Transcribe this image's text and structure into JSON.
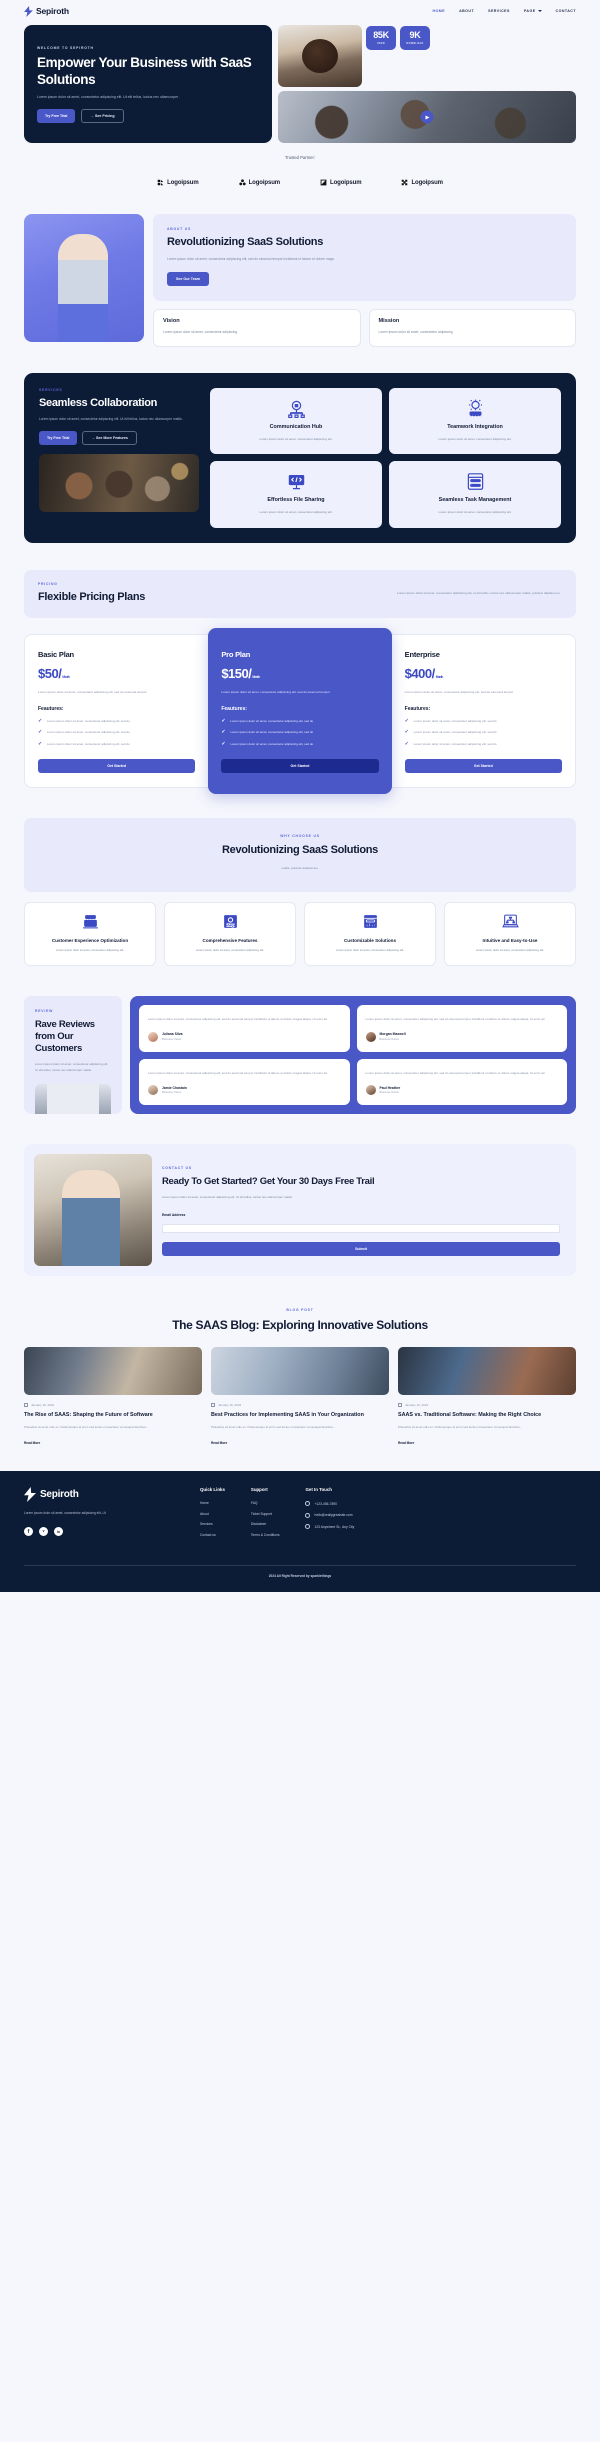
{
  "brand": {
    "name": "Sepiroth",
    "logo_icon": "lightning-bolt-icon"
  },
  "nav": {
    "items": [
      {
        "label": "HOME",
        "active": true
      },
      {
        "label": "ABOUT",
        "active": false
      },
      {
        "label": "SERVICES",
        "active": false
      },
      {
        "label": "PAGE",
        "active": false,
        "has_caret": true
      },
      {
        "label": "CONTACT",
        "active": false
      }
    ]
  },
  "hero": {
    "eyebrow": "WELCOME TO SEPIROTH",
    "title": "Empower Your Business with SaaS Solutions",
    "description": "Lorem ipsum dolor sit amet, consectetur adipiscing elit. Ut elit tellus, luctus nec ullamcorper .",
    "primary_btn": "Try Free Trial",
    "secondary_btn": "See Pricing",
    "secondary_btn_arrow": "→",
    "stats": [
      {
        "number": "85K",
        "label": "USER"
      },
      {
        "number": "9K",
        "label": "DOWNLOAD"
      }
    ],
    "play_icon": "play-icon"
  },
  "partners": {
    "title": "Trusted Partner:",
    "items": [
      {
        "name": "Logoipsum",
        "icon": "logoipsum-blocks-icon"
      },
      {
        "name": "Logoipsum",
        "icon": "logoipsum-clover-icon"
      },
      {
        "name": "Logoipsum",
        "icon": "logoipsum-leaf-icon"
      },
      {
        "name": "Logoipsum",
        "icon": "logoipsum-cross-icon"
      }
    ]
  },
  "about": {
    "eyebrow": "ABOUT US",
    "title": "Revolutionizing SaaS Solutions",
    "description": "Lorem ipsum dolor sit amet, consectetur adipiscing elit, sed do eiusmod tempor incididunt ut labore et dolore magn.",
    "button": "See Our Team",
    "cards": [
      {
        "title": "Vision",
        "text": "Lorem ipsum dolor sit amet, consectetur adipiscing"
      },
      {
        "title": "Mission",
        "text": "Lorem ipsum dolor sit amet, consectetur adipiscing"
      }
    ]
  },
  "services": {
    "eyebrow": "SERVICES",
    "title": "Seamless Collaboration",
    "description": "Lorem ipsum dolor sit amet, consectetur adipiscing elit. Ut elit tellus, luctus nec ullamcorper mattis.",
    "primary_btn": "Try Free Trial",
    "secondary_btn": "See More Features",
    "secondary_btn_arrow": "→",
    "cards": [
      {
        "title": "Communication Hub",
        "text": "Lorem ipsum dolor sit amet, consectetur adipiscing elit.",
        "icon": "network-lock-icon"
      },
      {
        "title": "Teamwork Integration",
        "text": "Lorem ipsum dolor sit amet, consectetur adipiscing elit.",
        "icon": "lightbulb-stars-icon"
      },
      {
        "title": "Effortless File Sharing",
        "text": "Lorem ipsum dolor sit amet, consectetur adipiscing elit.",
        "icon": "monitor-code-icon"
      },
      {
        "title": "Seamless Task Management",
        "text": "Lorem ipsum dolor sit amet, consectetur adipiscing elit.",
        "icon": "task-list-icon"
      }
    ]
  },
  "pricing": {
    "eyebrow": "PRICING",
    "title": "Flexible Pricing Plans",
    "description": "Lorem ipsum dolor sit amet, consectetur adipiscing elit, ut elit tellus, luctus nec ullamcorper mattis, pulvinar dapibus leo.",
    "features_label": "Feautures:",
    "plans": [
      {
        "name": "Basic Plan",
        "price": "$50/",
        "period": "Month",
        "description": "Lorem ipsum dolor sit amet, consectetur adipiscing elit, sed do eiuemod tempor",
        "features": [
          "Lorem ipsum dolor sit amet, consectetur adipiscing elit, sed do",
          "Lorem ipsum dolor sit amet, consectetur adipiscing elit, sed do",
          "Lorem ipsum dolor sit amet, consectetur adipiscing elit, sed do"
        ],
        "button": "Get Started",
        "featured": false
      },
      {
        "name": "Pro Plan",
        "price": "$150/",
        "period": "Month",
        "description": "Lorem ipsum dolor sit amet, consectetur adipiscing elit, sed do eiuemod tempor",
        "features": [
          "Lorem ipsum dolor sit amet, consectetur adipiscing elit, sed do",
          "Lorem ipsum dolor sit amet, consectetur adipiscing elit, sed do",
          "Lorem ipsum dolor sit amet, consectetur adipiscing elit, sed do"
        ],
        "button": "Get Started",
        "featured": true
      },
      {
        "name": "Enterprise",
        "price": "$400/",
        "period": "Month",
        "description": "Lorem ipsum dolor sit amet, consectetur adipiscing elit, sed do eiuemod tempor",
        "features": [
          "Lorem ipsum dolor sit amet, consectetur adipiscing elit, sed do",
          "Lorem ipsum dolor sit amet, consectetur adipiscing elit, sed do",
          "Lorem ipsum dolor sit amet, consectetur adipiscing elit, sed do"
        ],
        "button": "Get Started",
        "featured": false
      }
    ]
  },
  "why": {
    "eyebrow": "WHY CHOOSE US",
    "title": "Revolutionizing SaaS Solutions",
    "description": "mattis, pulvinar dapibus leo.",
    "cards": [
      {
        "title": "Customer Experience Optimization",
        "text": "Lorem ipsum dolor sit amet, consectetur adipiscing elit.",
        "icon": "monitor-stars-icon"
      },
      {
        "title": "Comprehensive Features",
        "text": "Lorem ipsum dolor sit amet, consectetur adipiscing elit.",
        "icon": "settings-sliders-icon"
      },
      {
        "title": "Customizable Solutions",
        "text": "Lorem ipsum dolor sit amet, consectetur adipiscing elit.",
        "icon": "dashboard-chart-icon"
      },
      {
        "title": "Intuitive and Easy-to-Use",
        "text": "Lorem ipsum dolor sit amet, consectetur adipiscing elit.",
        "icon": "laptop-flow-icon"
      }
    ]
  },
  "reviews": {
    "eyebrow": "REVIEW",
    "title": "Rave Reviews from Our Customers",
    "description": "Lorem ipsum dolor sit amet, consectetur adipiscing elit. Ut elit tellus, luctus nec ullamcorper mattis.",
    "items": [
      {
        "text": "Lorem ipsum dolor sit amet, consectetur adipiscing elit, sed do eiuemod tempor incididunt ut labore et dolore magna aliqua. Ut enim ad",
        "name": "Juliana Silva",
        "role": "Business Owner"
      },
      {
        "text": "Lorem ipsum dolor sit amet, consectetur adipiscing elit, sed do eiuemod tempor incididunt ut labore et dolore magna aliqua. Ut enim ad",
        "name": "Morgan Maxwell",
        "role": "Business Owner"
      },
      {
        "text": "Lorem ipsum dolor sit amet, consectetur adipiscing elit, sed do eiuemod tempor incididunt ut labore et dolore magna aliqua. Ut enim ad",
        "name": "Jamie Chastain",
        "role": "Business Owner"
      },
      {
        "text": "Lorem ipsum dolor sit amet, consectetur adipiscing elit, sed do eiuemod tempor incididunt ut labore et dolore magna aliqua. Ut enim ad",
        "name": "Paul Heather",
        "role": "Business Owner"
      }
    ]
  },
  "cta": {
    "eyebrow": "CONTACT US",
    "title": "Ready To Get Started? Get Your 30 Days Free Trail",
    "description": "Lorem ipsum dolor sit amet, consectetur adipiscing elit. Ut elit tellus, luctus nec ullamcorper mattis.",
    "email_label": "Email Address",
    "email_value": "",
    "email_placeholder": "",
    "submit": "Submit"
  },
  "blog": {
    "eyebrow": "BLOG POST",
    "title": "The SAAS Blog: Exploring Innovative Solutions",
    "posts": [
      {
        "date": "January 16, 2022",
        "title": "The Rise of SAAS: Shaping the Future of Software",
        "excerpt": "Phasellus sit amet odio ex. Pellentesque id enim sed lectus consectetur consequat faucibus...",
        "link": "Read More"
      },
      {
        "date": "January 16, 2022",
        "title": "Best Practices for Implementing SAAS in Your Organization",
        "excerpt": "Phasellus sit amet odio ex. Pellentesque id enim sed lectus consectetur consequat faucibus...",
        "link": "Read More"
      },
      {
        "date": "January 16, 2022",
        "title": "SAAS vs. Traditional Software: Making the Right Choice",
        "excerpt": "Phasellus sit amet odio ex. Pellentesque id enim sed lectus consectetur consequat faucibus...",
        "link": "Read More"
      }
    ]
  },
  "footer": {
    "brand_name": "Sepiroth",
    "description": "Lorem ipsum dolor sit amet, consectetur adipiscing elit, Ut",
    "socials": [
      {
        "name": "facebook-icon",
        "glyph": "f"
      },
      {
        "name": "twitter-icon",
        "glyph": "ᵛ"
      },
      {
        "name": "linkedin-icon",
        "glyph": "in"
      }
    ],
    "columns": [
      {
        "title": "Quick Links",
        "links": [
          "Home",
          "About",
          "Services",
          "Contact us"
        ]
      },
      {
        "title": "Support",
        "links": [
          "FAQ",
          "Ticket Support",
          "Disclaimer",
          "Terms & Conditions"
        ]
      }
    ],
    "contact": {
      "title": "Get In Touch",
      "items": [
        {
          "icon": "phone-icon",
          "text": "+123-456-7890"
        },
        {
          "icon": "mail-icon",
          "text": "hello@reallygreatsite.com"
        },
        {
          "icon": "location-icon",
          "text": "123 Anywhere St., Any City"
        }
      ]
    },
    "copyright": "2024 All Right Reserved by sparklethings"
  },
  "colors": {
    "accent": "#4a57c7",
    "dark": "#0d1c36",
    "light_bg": "#f6f7fc",
    "lavender": "#e8eafc"
  }
}
